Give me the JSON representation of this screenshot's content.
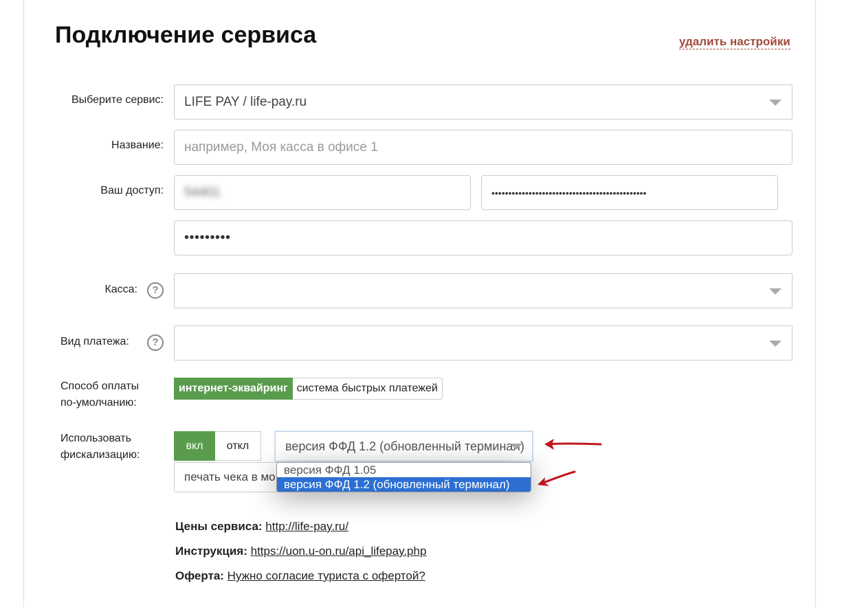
{
  "header": {
    "title": "Подключение сервиса",
    "delete_link": "удалить настройки"
  },
  "form": {
    "service": {
      "label": "Выберите сервис:",
      "value": "LIFE PAY / life-pay.ru"
    },
    "name": {
      "label": "Название:",
      "placeholder": "например, Моя касса в офисе 1"
    },
    "access": {
      "label": "Ваш доступ:",
      "login": "54401",
      "api_key": "••••••••••••••••••••••••••••••••••••••••••••••",
      "password": "•••••••••"
    },
    "cashbox": {
      "label": "Касса:",
      "value": ""
    },
    "payment_type": {
      "label": "Вид платежа:",
      "value": ""
    },
    "default_payment": {
      "label_line1": "Способ оплаты",
      "label_line2": "по-умолчанию:",
      "options": [
        "интернет-эквайринг",
        "система быстрых платежей"
      ],
      "selected": "интернет-эквайринг"
    },
    "fiscalization": {
      "label_line1": "Использовать",
      "label_line2": "фискализацию:",
      "on_label": "вкл",
      "off_label": "откл",
      "state": "вкл",
      "ffd_value": "версия ФФД 1.2 (обновленный терминал)",
      "ffd_options": [
        "версия ФФД 1.05",
        "версия ФФД 1.2 (обновленный терминал)"
      ],
      "ffd_selected": "версия ФФД 1.2 (обновленный терминал)",
      "print_field": "печать чека в мо"
    }
  },
  "info": {
    "prices_label": "Цены сервиса:",
    "prices_link": "http://life-pay.ru/",
    "instruction_label": "Инструкция:",
    "instruction_link": "https://uon.u-on.ru/api_lifepay.php",
    "offer_label": "Оферта:",
    "offer_link": "Нужно согласие туриста с офертой?"
  },
  "colors": {
    "accent_green": "#5a9c4e",
    "link_red": "#a24a3c",
    "highlight_blue": "#2c6fd1",
    "annotation_arrow": "#c0181c"
  }
}
